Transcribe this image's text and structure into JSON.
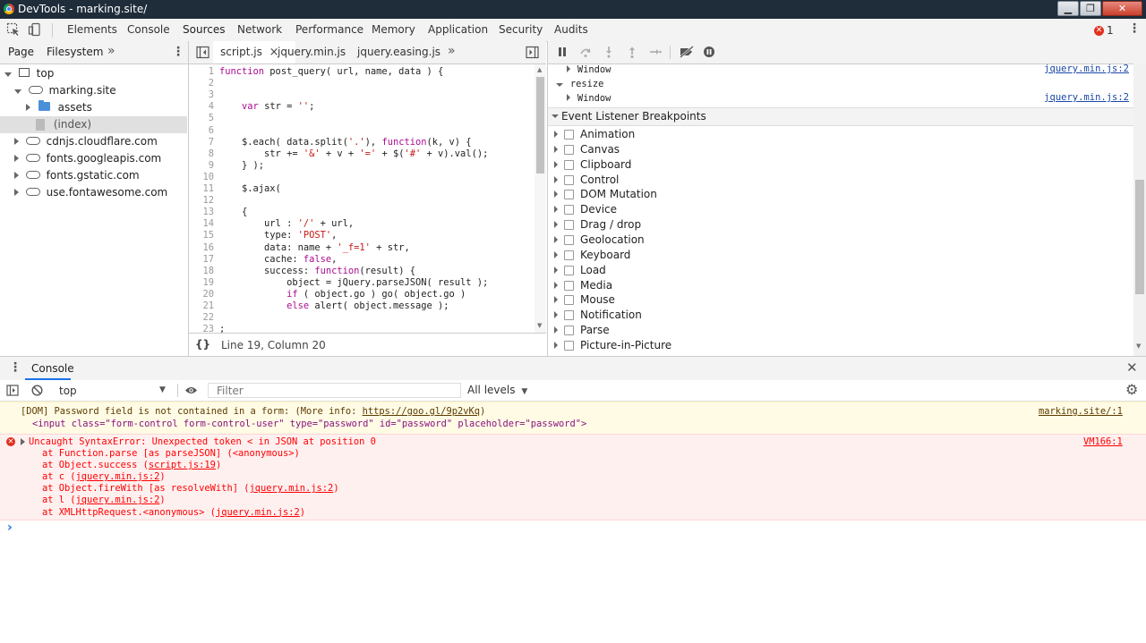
{
  "window": {
    "title": "DevTools - marking.site/"
  },
  "toolbar": {
    "tabs": [
      "Elements",
      "Console",
      "Sources",
      "Network",
      "Performance",
      "Memory",
      "Application",
      "Security",
      "Audits"
    ],
    "active_tab": "Sources",
    "error_count": "1"
  },
  "navigator": {
    "tabs": [
      "Page",
      "Filesystem"
    ],
    "more": "»",
    "tree": [
      "top",
      "marking.site",
      "assets",
      "(index)",
      "cdnjs.cloudflare.com",
      "fonts.googleapis.com",
      "fonts.gstatic.com",
      "use.fontawesome.com"
    ]
  },
  "editor": {
    "tabs": [
      "script.js",
      "jquery.min.js",
      "jquery.easing.js"
    ],
    "close_glyph": "×",
    "more": "»",
    "status": "Line 19, Column 20",
    "pretty_print": "{}",
    "lines": [
      {
        "n": "1",
        "t": "function post_query( url, name, data ) {"
      },
      {
        "n": "2",
        "t": ""
      },
      {
        "n": "3",
        "t": ""
      },
      {
        "n": "4",
        "t": "    var str = '';"
      },
      {
        "n": "5",
        "t": ""
      },
      {
        "n": "6",
        "t": ""
      },
      {
        "n": "7",
        "t": "    $.each( data.split('.'), function(k, v) {"
      },
      {
        "n": "8",
        "t": "        str += '&' + v + '=' + $('#' + v).val();"
      },
      {
        "n": "9",
        "t": "    } );"
      },
      {
        "n": "10",
        "t": ""
      },
      {
        "n": "11",
        "t": "    $.ajax("
      },
      {
        "n": "12",
        "t": ""
      },
      {
        "n": "13",
        "t": "    {"
      },
      {
        "n": "14",
        "t": "        url : '/' + url,"
      },
      {
        "n": "15",
        "t": "        type: 'POST',"
      },
      {
        "n": "16",
        "t": "        data: name + '_f=1' + str,"
      },
      {
        "n": "17",
        "t": "        cache: false,"
      },
      {
        "n": "18",
        "t": "        success: function(result) {"
      },
      {
        "n": "19",
        "t": "            object = jQuery.parseJSON( result );"
      },
      {
        "n": "20",
        "t": "            if ( object.go ) go( object.go )"
      },
      {
        "n": "21",
        "t": "            else alert( object.message );"
      },
      {
        "n": "22",
        "t": ""
      },
      {
        "n": "23",
        "t": ";"
      }
    ]
  },
  "debugger": {
    "listeners": [
      {
        "label": "Window",
        "link": "jquery.min.js:2"
      },
      {
        "label": "resize",
        "link": ""
      },
      {
        "label": "Window",
        "link": "jquery.min.js:2"
      }
    ],
    "section_title": "Event Listener Breakpoints",
    "breakpoints": [
      "Animation",
      "Canvas",
      "Clipboard",
      "Control",
      "DOM Mutation",
      "Device",
      "Drag / drop",
      "Geolocation",
      "Keyboard",
      "Load",
      "Media",
      "Mouse",
      "Notification",
      "Parse",
      "Picture-in-Picture"
    ]
  },
  "console": {
    "drawer_tab": "Console",
    "context": "top",
    "filter_placeholder": "Filter",
    "levels": "All levels",
    "warning": {
      "line1_prefix": "[DOM] Password field is not contained in a form: (More info: ",
      "line1_link": "https://goo.gl/9p2vKq",
      "line1_suffix": ")",
      "line2": "<input class=\"form-control form-control-user\" type=\"password\" id=\"password\" placeholder=\"password\">",
      "source": "marking.site/:1"
    },
    "error": {
      "message": "Uncaught SyntaxError: Unexpected token < in JSON at position 0",
      "source": "VM166:1",
      "stack": [
        {
          "pre": "at Function.parse [as parseJSON] (<anonymous>)",
          "link": "",
          "post": ""
        },
        {
          "pre": "at Object.success (",
          "link": "script.js:19",
          "post": ")"
        },
        {
          "pre": "at c (",
          "link": "jquery.min.js:2",
          "post": ")"
        },
        {
          "pre": "at Object.fireWith [as resolveWith] (",
          "link": "jquery.min.js:2",
          "post": ")"
        },
        {
          "pre": "at l (",
          "link": "jquery.min.js:2",
          "post": ")"
        },
        {
          "pre": "at XMLHttpRequest.<anonymous> (",
          "link": "jquery.min.js:2",
          "post": ")"
        }
      ]
    },
    "prompt": "›"
  },
  "colors": {
    "accent": "#1a73e8",
    "error_bg": "#fff0f0",
    "error_text": "#ff0000",
    "warning_bg": "#fffbe5",
    "warning_text": "#5c3c00"
  }
}
